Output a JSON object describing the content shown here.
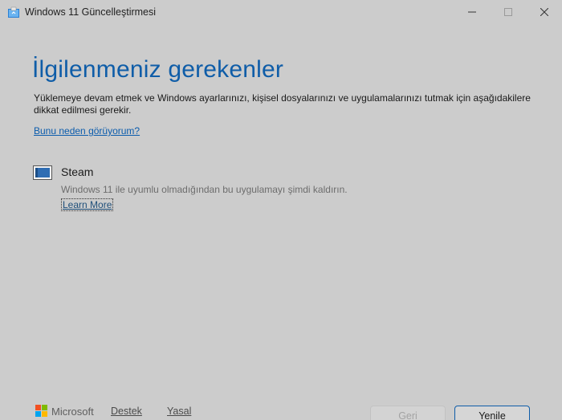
{
  "window": {
    "title": "Windows 11 Güncelleştirmesi",
    "icon": "windows-update-icon",
    "controls": [
      "minimize-icon",
      "maximize-icon",
      "close-icon"
    ]
  },
  "main": {
    "heading": "İlgilenmeniz gerekenler",
    "intro": "Yüklemeye devam etmek ve Windows ayarlarınızı, kişisel dosyalarınızı ve uygulamalarınızı tutmak için aşağıdakilere dikkat edilmesi gerekir.",
    "why_link": "Bunu neden görüyorum?",
    "items": [
      {
        "name": "Steam",
        "icon": "app-window-icon",
        "description": "Windows 11 ile uyumlu olmadığından bu uygulamayı şimdi kaldırın.",
        "link": "Learn More"
      }
    ]
  },
  "footer": {
    "brand": "Microsoft",
    "links": [
      "Destek",
      "Yasal"
    ],
    "back_label": "Geri",
    "refresh_label": "Yenile"
  },
  "colors": {
    "background": "#cccccc",
    "accent": "#0f5da8",
    "ms_red": "#f25022",
    "ms_green": "#7fba00",
    "ms_blue": "#00a4ef",
    "ms_yellow": "#ffb900"
  }
}
